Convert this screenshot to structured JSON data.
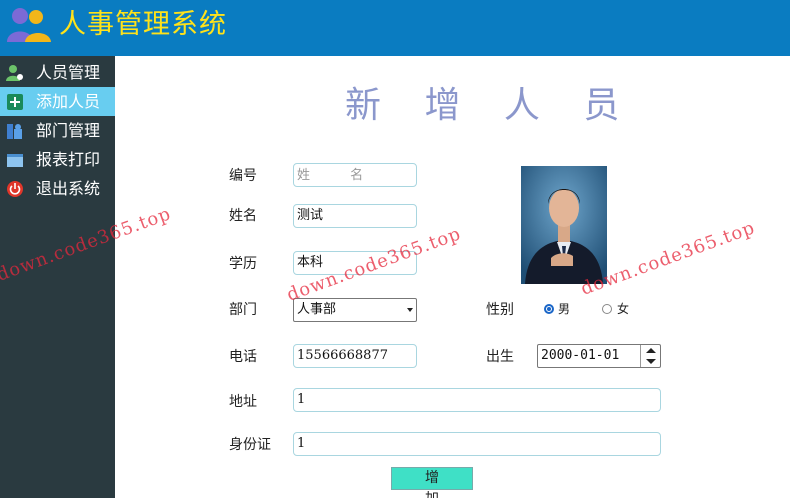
{
  "header": {
    "title": "人事管理系统",
    "logo_icon": "users-logo-icon",
    "bg_color": "#0a7cc1",
    "title_color": "#ffe21a"
  },
  "sidebar": {
    "active_index": 1,
    "items": [
      {
        "label": "人员管理",
        "icon": "user-manage-icon"
      },
      {
        "label": "添加人员",
        "icon": "add-icon"
      },
      {
        "label": "部门管理",
        "icon": "department-icon"
      },
      {
        "label": "报表打印",
        "icon": "report-icon"
      },
      {
        "label": "退出系统",
        "icon": "power-icon"
      }
    ]
  },
  "form": {
    "title": "新 增 人 员",
    "id_label": "编号",
    "id_placeholder": "姓 名",
    "name_label": "姓名",
    "name_value": "测试",
    "edu_label": "学历",
    "edu_value": "本科",
    "dept_label": "部门",
    "dept_value": "人事部",
    "gender_label": "性别",
    "gender_male": "男",
    "gender_female": "女",
    "gender_selected": "男",
    "phone_label": "电话",
    "phone_value": "15566668877",
    "birth_label": "出生",
    "birth_value": "2000-01-01",
    "address_label": "地址",
    "address_value": "1",
    "idcard_label": "身份证",
    "idcard_value": "1",
    "submit_label": "增 加"
  },
  "watermark": "down.code365.top"
}
